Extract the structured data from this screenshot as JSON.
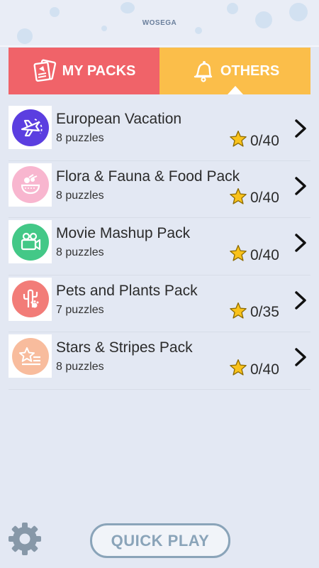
{
  "header": {
    "brand": "WOSEGA"
  },
  "tabs": [
    {
      "label": "MY PACKS",
      "icon": "packs-icon",
      "color": "#f06369"
    },
    {
      "label": "OTHERS",
      "icon": "bell-icon",
      "color": "#fbbe4a",
      "selected": true
    }
  ],
  "packs": [
    {
      "title": "European Vacation",
      "subtitle": "8 puzzles",
      "score": "0/40",
      "icon": "plane-icon",
      "color": "#5b3ee0"
    },
    {
      "title": "Flora & Fauna & Food Pack",
      "subtitle": "8 puzzles",
      "score": "0/40",
      "icon": "food-bowl-icon",
      "color": "#f8b6cf"
    },
    {
      "title": "Movie Mashup Pack",
      "subtitle": "8 puzzles",
      "score": "0/40",
      "icon": "movie-camera-icon",
      "color": "#43c887"
    },
    {
      "title": "Pets and Plants Pack",
      "subtitle": "7 puzzles",
      "score": "0/35",
      "icon": "cactus-icon",
      "color": "#f27c78"
    },
    {
      "title": "Stars & Stripes Pack",
      "subtitle": "8 puzzles",
      "score": "0/40",
      "icon": "star-stripes-icon",
      "color": "#f8bc9d"
    }
  ],
  "footer": {
    "quick_play": "QUICK PLAY",
    "settings_icon": "gear-icon"
  }
}
